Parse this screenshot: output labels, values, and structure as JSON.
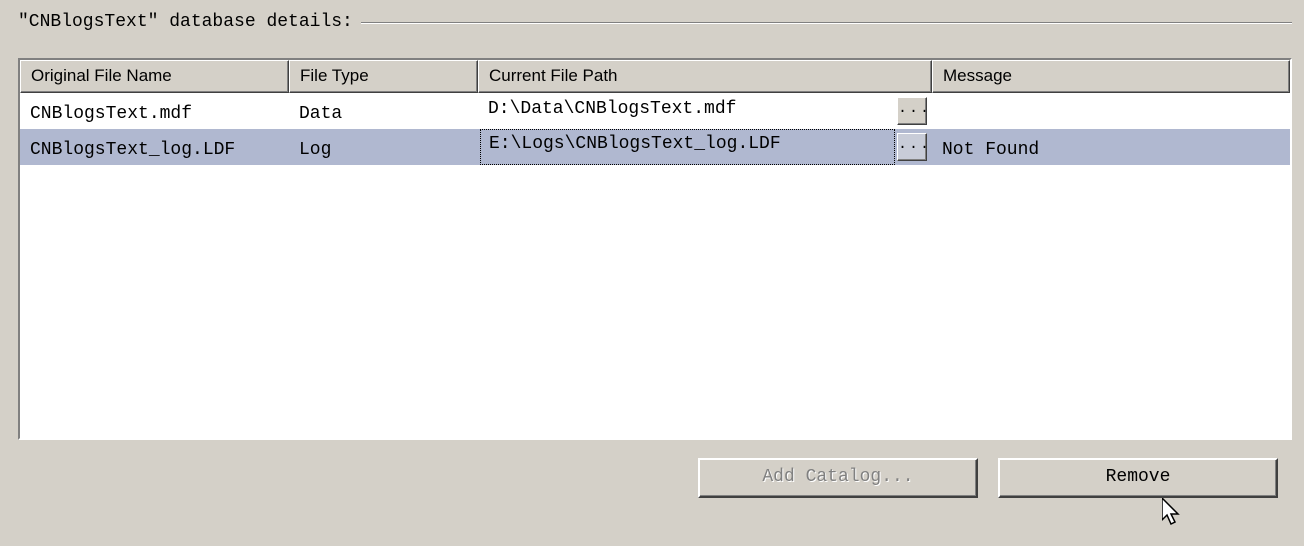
{
  "group": {
    "title": "\"CNBlogsText\" database details:"
  },
  "table": {
    "headers": {
      "original": "Original File Name",
      "filetype": "File Type",
      "path": "Current File Path",
      "message": "Message"
    },
    "rows": [
      {
        "original": "CNBlogsText.mdf",
        "filetype": "Data",
        "path": "D:\\Data\\CNBlogsText.mdf",
        "message": "",
        "selected": false,
        "focused": false,
        "browse_label": "..."
      },
      {
        "original": "CNBlogsText_log.LDF",
        "filetype": "Log",
        "path": "E:\\Logs\\CNBlogsText_log.LDF",
        "message": "Not Found",
        "selected": true,
        "focused": true,
        "browse_label": "..."
      }
    ]
  },
  "buttons": {
    "add_catalog": "Add Catalog...",
    "remove": "Remove"
  }
}
